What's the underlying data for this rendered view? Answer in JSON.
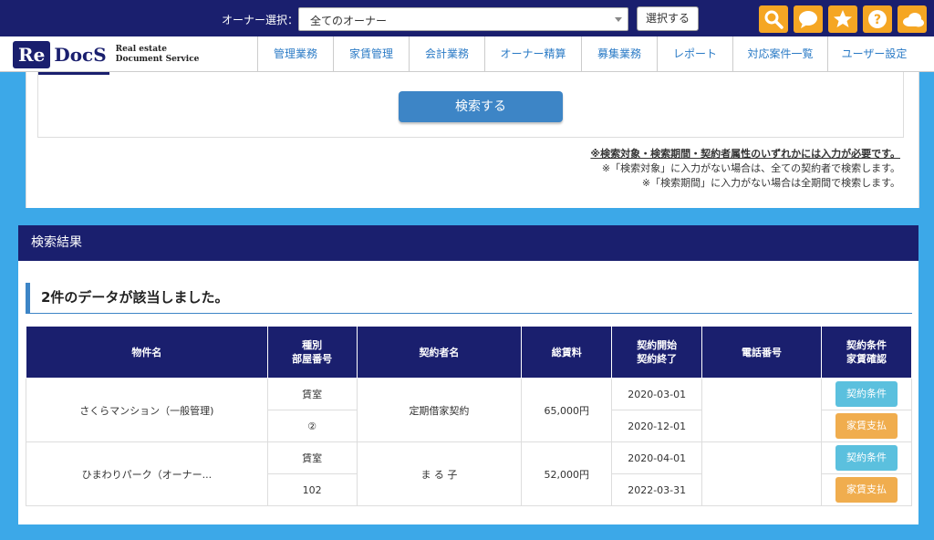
{
  "topbar": {
    "owner_label": "オーナー選択：",
    "owner_value": "全てのオーナー",
    "select_button": "選択する",
    "icons": [
      "search-icon",
      "chat-icon",
      "star-icon",
      "help-icon",
      "cloud-icon"
    ],
    "icon_color": "#f5a623"
  },
  "logo": {
    "re": "Re",
    "docs": "DocS",
    "sub1": "Real estate",
    "sub2": "Document Service"
  },
  "nav": [
    "管理業務",
    "家賃管理",
    "会計業務",
    "オーナー精算",
    "募集業務",
    "レポート",
    "対応案件一覧",
    "ユーザー設定"
  ],
  "search": {
    "button": "検索する",
    "note1": "※検索対象・検索期間・契約者属性のいずれかには入力が必要です。",
    "note2": "※「検索対象」に入力がない場合は、全ての契約者で検索します。",
    "note3": "※「検索期間」に入力がない場合は全期間で検索します。"
  },
  "results": {
    "header": "検索結果",
    "count_text": "2件のデータが該当しました。",
    "columns": {
      "property": "物件名",
      "type1": "種別",
      "type2": "部屋番号",
      "contractor": "契約者名",
      "rent": "総賃料",
      "start": "契約開始",
      "end": "契約終了",
      "phone": "電話番号",
      "cond1": "契約条件",
      "cond2": "家賃確認"
    },
    "rows": [
      {
        "property": "さくらマンション（一般管理)",
        "type": "賃室",
        "room": "②",
        "contractor": "定期借家契約",
        "rent": "65,000円",
        "start": "2020-03-01",
        "end": "2020-12-01",
        "phone": "",
        "cond_btn": "契約条件",
        "pay_btn": "家賃支払"
      },
      {
        "property": "ひまわりパーク（オーナー...",
        "type": "賃室",
        "room": "102",
        "contractor": "ま る 子",
        "rent": "52,000円",
        "start": "2020-04-01",
        "end": "2022-03-31",
        "phone": "",
        "cond_btn": "契約条件",
        "pay_btn": "家賃支払"
      }
    ]
  }
}
